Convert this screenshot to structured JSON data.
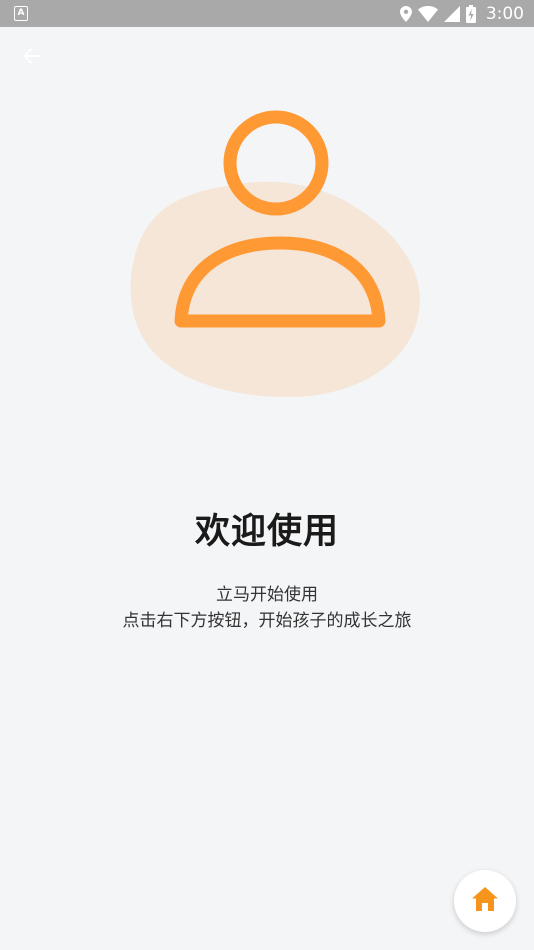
{
  "status_bar": {
    "notification_icon_letter": "A",
    "time": "3:00",
    "icons": [
      "location-icon",
      "wifi-icon",
      "signal-icon",
      "battery-charging-icon"
    ]
  },
  "header": {
    "back_icon": "arrow-left-icon"
  },
  "illustration": {
    "icon": "user-icon",
    "accent_color": "#ff9933",
    "blob_color": "#f5e6d8"
  },
  "welcome": {
    "title": "欢迎使用",
    "subtitle_line1": "立马开始使用",
    "subtitle_line2": "点击右下方按钮，开始孩子的成长之旅"
  },
  "fab": {
    "icon": "home-icon",
    "color": "#f7941d"
  }
}
